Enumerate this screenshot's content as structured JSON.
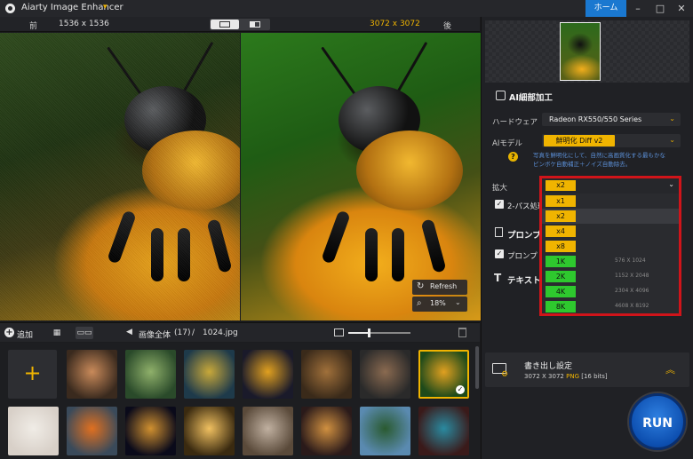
{
  "app": {
    "title": "Aiarty Image Enhancer",
    "home_label": "ホーム"
  },
  "preview": {
    "before_label": "前",
    "before_size": "1536 x 1536",
    "after_size": "3072 x 3072",
    "after_label": "後",
    "refresh_label": "Refresh",
    "zoom": "18%"
  },
  "library": {
    "add_label": "追加",
    "path_label": "画像全体",
    "count": "(17)",
    "separator": "/",
    "current_file": "1024.jpg",
    "zoom_fraction": 0.33
  },
  "panel": {
    "section_ai": "AI細部加工",
    "hardware_label": "ハードウェア",
    "hardware_value": "Radeon RX550/550 Series",
    "model_label": "AIモデル",
    "model_value": "鮮明化 Diff v2",
    "model_desc_1": "写真を鮮明化にして、自然に高画質化する最もかな",
    "model_desc_2": "ピンボケ自動補正＋ノイズ自動除去。",
    "scale_label": "拡大",
    "scale_value": "x2",
    "twopass_label": "2-パス処理",
    "prompt_section_label": "プロンプ",
    "prompt_check_label": "プロンプト",
    "text_section_label": "テキスト"
  },
  "scale_options": [
    {
      "label": "x1",
      "color": "yellow",
      "res": ""
    },
    {
      "label": "x2",
      "color": "yellow",
      "res": "",
      "highlighted": true
    },
    {
      "label": "x4",
      "color": "yellow",
      "res": ""
    },
    {
      "label": "x8",
      "color": "yellow",
      "res": ""
    },
    {
      "label": "1K",
      "color": "green",
      "res": "576 X 1024"
    },
    {
      "label": "2K",
      "color": "green",
      "res": "1152 X 2048"
    },
    {
      "label": "4K",
      "color": "green",
      "res": "2304 X 4096"
    },
    {
      "label": "8K",
      "color": "green",
      "res": "4608 X 8192"
    }
  ],
  "export": {
    "title": "書き出し設定",
    "size": "3072 X 3072",
    "format": "PNG",
    "bits": "[16 bits]"
  },
  "run_label": "RUN",
  "colors": {
    "accent": "#f0b400",
    "highlight_border": "#d0141a",
    "home_blue": "#1a78d0",
    "green_chip": "#2ec82e"
  },
  "gallery_icons": [
    "portrait-thumb",
    "landscape-thumb",
    "fantasy-thumb",
    "butterfly-thumb",
    "tiger-thumb",
    "man-thumb",
    "bee-thumb",
    "girl-thumb",
    "kingfisher-thumb",
    "city-night-thumb",
    "perfume-thumb",
    "interior-thumb",
    "pancake-thumb",
    "island-thumb",
    "dragon-thumb"
  ]
}
